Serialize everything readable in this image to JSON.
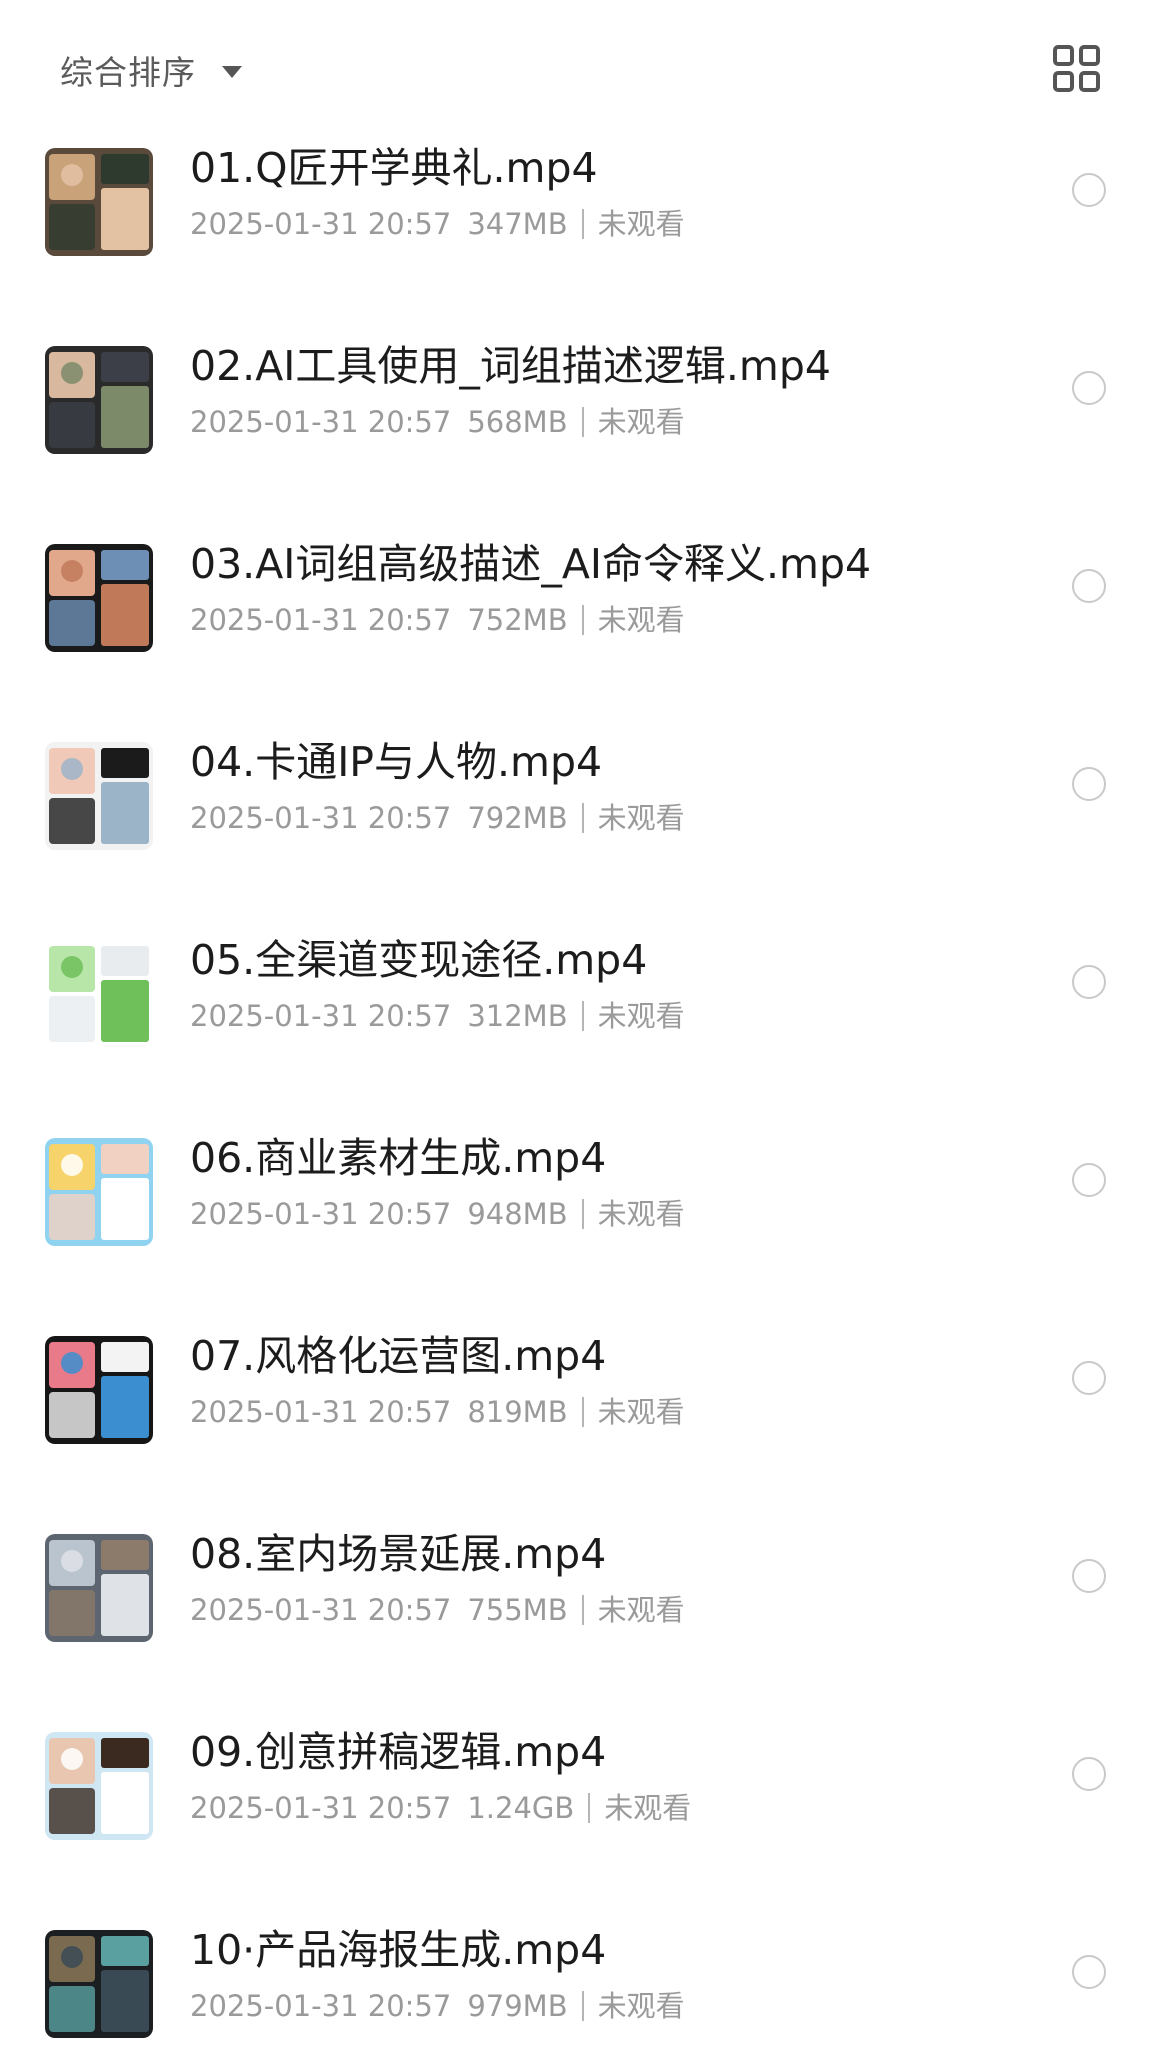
{
  "header": {
    "sort_label": "综合排序"
  },
  "files": [
    {
      "title": "01.Q匠开学典礼.mp4",
      "date": "2025-01-31 20:57",
      "size": "347MB",
      "status": "未观看"
    },
    {
      "title": "02.AI工具使用_词组描述逻辑.mp4",
      "date": "2025-01-31 20:57",
      "size": "568MB",
      "status": "未观看"
    },
    {
      "title": "03.AI词组高级描述_AI命令释义.mp4",
      "date": "2025-01-31 20:57",
      "size": "752MB",
      "status": "未观看"
    },
    {
      "title": "04.卡通IP与人物.mp4",
      "date": "2025-01-31 20:57",
      "size": "792MB",
      "status": "未观看"
    },
    {
      "title": "05.全渠道变现途径.mp4",
      "date": "2025-01-31 20:57",
      "size": "312MB",
      "status": "未观看"
    },
    {
      "title": "06.商业素材生成.mp4",
      "date": "2025-01-31 20:57",
      "size": "948MB",
      "status": "未观看"
    },
    {
      "title": "07.风格化运营图.mp4",
      "date": "2025-01-31 20:57",
      "size": "819MB",
      "status": "未观看"
    },
    {
      "title": "08.室内场景延展.mp4",
      "date": "2025-01-31 20:57",
      "size": "755MB",
      "status": "未观看"
    },
    {
      "title": "09.创意拼稿逻辑.mp4",
      "date": "2025-01-31 20:57",
      "size": "1.24GB",
      "status": "未观看"
    },
    {
      "title": "10·产品海报生成.mp4",
      "date": "2025-01-31 20:57",
      "size": "979MB",
      "status": "未观看"
    }
  ],
  "icons": {
    "sort_caret": "caret-down-icon",
    "view_toggle": "grid-view-icon",
    "row_select": "radio-circle-icon",
    "thumbnail": "video-thumbnail"
  }
}
